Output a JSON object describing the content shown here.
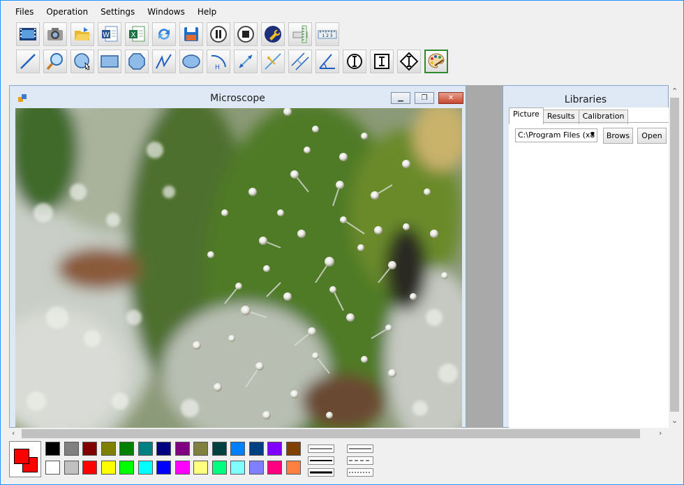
{
  "menu": [
    "Files",
    "Operation",
    "Settings",
    "Windows",
    "Help"
  ],
  "toolbar_row1": [
    "video-icon",
    "camera-icon",
    "open-folder-icon",
    "word-icon",
    "excel-icon",
    "refresh-icon",
    "save-icon",
    "pause-icon",
    "stop-icon",
    "wrench-icon",
    "ruler-vertical-icon",
    "ruler-horizontal-icon"
  ],
  "toolbar_row2": [
    "line-tool-icon",
    "zoom-icon",
    "circle-select-icon",
    "rectangle-icon",
    "polygon-icon",
    "polyline-icon",
    "ellipse-icon",
    "arc-height-icon",
    "measure-line-icon",
    "point-line-icon",
    "parallel-line-icon",
    "angle-icon",
    "inner-diameter-icon",
    "height-tool-icon",
    "vertical-diameter-icon",
    "palette-icon"
  ],
  "microscope": {
    "title": "Microscope"
  },
  "libraries": {
    "title": "Libraries",
    "tabs": [
      "Picture",
      "Results",
      "Calibration"
    ],
    "path_value": "C:\\Program Files (x8",
    "browse_label": "Brows",
    "open_label": "Open"
  },
  "colors": {
    "current_fg": "#ff0000",
    "current_bg": "#ff0000",
    "row1": [
      "#000000",
      "#808080",
      "#800000",
      "#808000",
      "#008000",
      "#008080",
      "#000080",
      "#800080",
      "#808040",
      "#004040",
      "#0080ff",
      "#004080",
      "#8000ff",
      "#804000"
    ],
    "row2": [
      "#ffffff",
      "#c0c0c0",
      "#ff0000",
      "#ffff00",
      "#00ff00",
      "#00ffff",
      "#0000ff",
      "#ff00ff",
      "#ffff80",
      "#00ff80",
      "#80ffff",
      "#8080ff",
      "#ff0080",
      "#ff8040"
    ]
  }
}
